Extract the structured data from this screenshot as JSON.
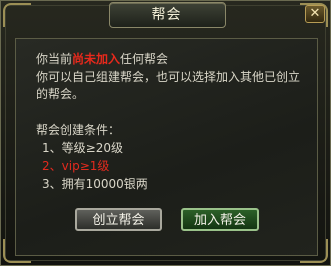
{
  "window": {
    "title": "帮会",
    "close_glyph": "✕"
  },
  "intro": {
    "line1_prefix": "你当前",
    "line1_highlight": "尚未加入",
    "line1_suffix": "任何帮会",
    "line2": "你可以自己组建帮会，也可以选择加入其他已创立",
    "line3": "的帮会。"
  },
  "conditions": {
    "heading": "帮会创建条件：",
    "items": [
      "1、等级≥20级",
      "2、vip≥1级",
      "3、拥有10000银两"
    ],
    "unmet_index": 1
  },
  "buttons": {
    "create_label": "创立帮会",
    "join_label": "加入帮会"
  },
  "colors": {
    "highlight": "#e8291c",
    "unmet": "#e22a1e",
    "text": "#d9d6c8",
    "join_button": "#2c6028"
  }
}
